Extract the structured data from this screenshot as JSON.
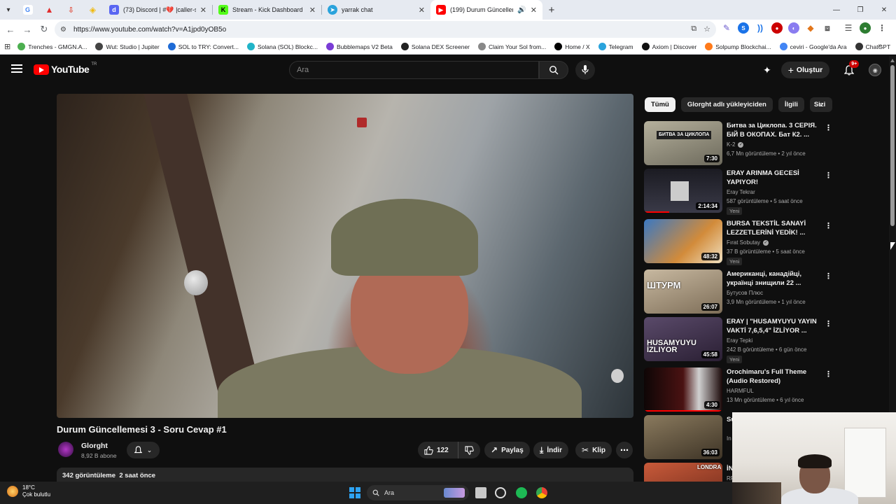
{
  "browser": {
    "tabs": [
      {
        "title": "(73) Discord | #💔 |caller-spotli",
        "active": false,
        "favicon_color": "#5865f2"
      },
      {
        "title": "Stream - Kick Dashboard",
        "active": false,
        "favicon_color": "#53fc18"
      },
      {
        "title": "yarrak chat",
        "active": false,
        "favicon_color": "#2aa3dc"
      },
      {
        "title": "(199) Durum Güncellemesi",
        "active": true,
        "favicon_color": "#ff0000"
      }
    ],
    "url": "https://www.youtube.com/watch?v=A1jpd0yOB5o",
    "bookmarks": [
      {
        "label": "Trenches - GMGN.A...",
        "color": "#4caf50"
      },
      {
        "label": "Wut: Studio | Jupiter",
        "color": "#444444"
      },
      {
        "label": "SOL to TRY: Convert...",
        "color": "#1e6bd6"
      },
      {
        "label": "Solana (SOL) Blockc...",
        "color": "#21b4c8"
      },
      {
        "label": "Bubblemaps V2 Beta",
        "color": "#7a3cd6"
      },
      {
        "label": "Solana DEX Screener",
        "color": "#222222"
      },
      {
        "label": "Claim Your Sol from...",
        "color": "#888888"
      },
      {
        "label": "Home / X",
        "color": "#000000"
      },
      {
        "label": "Telegram",
        "color": "#2aa3dc"
      },
      {
        "label": "Axiom | Discover",
        "color": "#111111"
      },
      {
        "label": "Solpump Blockchai...",
        "color": "#ff7a1a"
      },
      {
        "label": "ceviri - Google'da Ara",
        "color": "#4285f4"
      },
      {
        "label": "ChatGPT",
        "color": "#333333"
      }
    ]
  },
  "youtube": {
    "logo_text": "YouTube",
    "region": "TR",
    "search_placeholder": "Ara",
    "create_label": "Oluştur",
    "notif_count": "9+"
  },
  "video": {
    "title": "Durum Güncellemesi 3 - Soru Cevap #1",
    "channel": "Glorght",
    "subscribers": "8,92 B abone",
    "likes": "122",
    "share_label": "Paylaş",
    "download_label": "İndir",
    "clip_label": "Klip",
    "views": "342 görüntüleme",
    "published": "2 saat önce"
  },
  "sidebar": {
    "chips": [
      "Tümü",
      "Glorght adlı yükleyiciden",
      "İlgili",
      "Sizi"
    ],
    "items": [
      {
        "title": "Битва за Циклопа. 3 СЕРІЯ. БІЙ В ОКОПАХ. Бат К2. ...",
        "channel": "K-2",
        "verified": true,
        "meta": "6,7 Mn görüntüleme • 2 yıl önce",
        "duration": "7:30",
        "badge": "",
        "thumb_text": "БИТВА ЗА ЦИКЛОПА",
        "thumb_color": "#8a8676"
      },
      {
        "title": "ERAY ARINMA GECESİ YAPIYOR!",
        "channel": "Eray Tekrar",
        "verified": false,
        "meta": "587 görüntüleme • 5 saat önce",
        "duration": "2:14:34",
        "badge": "Yeni",
        "thumb_text": "",
        "thumb_color": "#1b1b22"
      },
      {
        "title": "BURSA TEKSTİL SANAYİ LEZZETLERİNİ YEDİK! ...",
        "channel": "Fırat Sobutay",
        "verified": true,
        "meta": "37 B görüntüleme • 5 saat önce",
        "duration": "48:32",
        "badge": "Yeni",
        "thumb_text": "",
        "thumb_color": "#3a78c2"
      },
      {
        "title": "Американці, канадійці, українці знищили 22 ...",
        "channel": "Бутусов Плюс",
        "verified": false,
        "meta": "3,9 Mn görüntüleme • 1 yıl önce",
        "duration": "26:07",
        "badge": "",
        "thumb_text": "ШТУРМ",
        "thumb_color": "#9a8a72"
      },
      {
        "title": "ERAY | \"HUSAMYUYU YAYIN VAKTİ 7,6,5,4\" İZLİYOR ...",
        "channel": "Eray Tepki",
        "verified": false,
        "meta": "242 B görüntüleme • 6 gün önce",
        "duration": "45:58",
        "badge": "Yeni",
        "thumb_text": "HUSAMYUYU İZLIYOR",
        "thumb_color": "#3a2a4a"
      },
      {
        "title": "Orochimaru's Full Theme (Audio Restored)",
        "channel": "HARMFUL",
        "verified": false,
        "meta": "13 Mn görüntüleme • 6 yıl önce",
        "duration": "4:30",
        "badge": "",
        "thumb_text": "",
        "thumb_color": "#2a0f0f"
      },
      {
        "title": "Su",
        "channel": "In",
        "verified": false,
        "meta": "",
        "duration": "36:03",
        "badge": "",
        "thumb_text": "",
        "thumb_color": "#6b5b43"
      },
      {
        "title": "İN",
        "channel": "RP",
        "verified": false,
        "meta": "",
        "duration": "",
        "badge": "",
        "thumb_text": "LONDRA",
        "thumb_color": "#b8412f"
      }
    ]
  },
  "taskbar": {
    "temperature": "18°C",
    "weather": "Çok bulutlu",
    "search_label": "Ara"
  }
}
